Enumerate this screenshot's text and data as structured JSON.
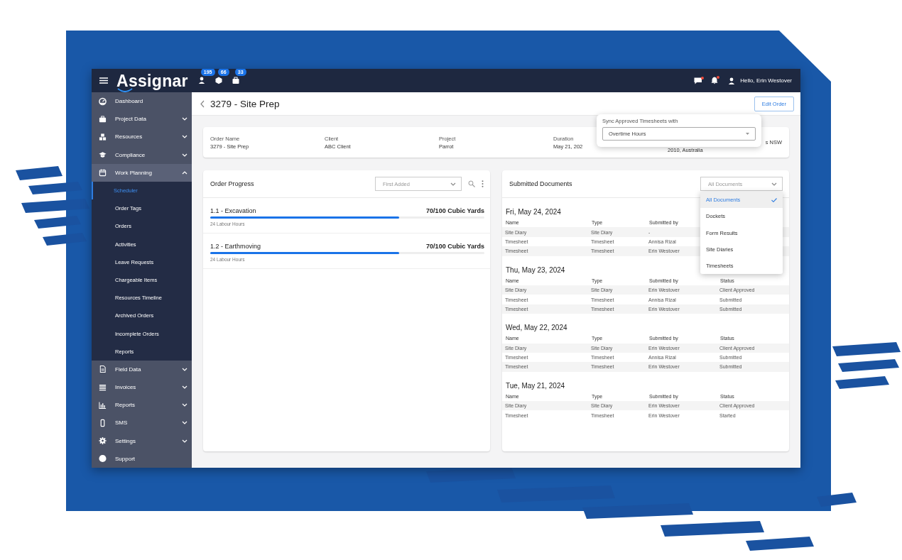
{
  "topbar": {
    "logo": "Assignar",
    "badges": [
      {
        "count": "195"
      },
      {
        "count": "66"
      },
      {
        "count": "33"
      }
    ],
    "greeting": "Hello, Erin Westover"
  },
  "sidebar": {
    "items": [
      {
        "label": "Dashboard"
      },
      {
        "label": "Project Data",
        "expanded": false
      },
      {
        "label": "Resources",
        "expanded": false
      },
      {
        "label": "Compliance",
        "expanded": false
      },
      {
        "label": "Work Planning",
        "expanded": true,
        "children": [
          {
            "label": "Scheduler",
            "selected": true
          },
          {
            "label": "Order Tags",
            "selected": false
          },
          {
            "label": "Orders",
            "selected": false
          },
          {
            "label": "Activities",
            "selected": false
          },
          {
            "label": "Leave Requests",
            "selected": false
          },
          {
            "label": "Chargeable Items",
            "selected": false
          },
          {
            "label": "Resources Timeline",
            "selected": false
          },
          {
            "label": "Archived Orders",
            "selected": false
          },
          {
            "label": "Incomplete Orders",
            "selected": false
          },
          {
            "label": "Reports",
            "selected": false
          }
        ]
      },
      {
        "label": "Field Data",
        "expanded": false
      },
      {
        "label": "Invoices",
        "expanded": false
      },
      {
        "label": "Reports",
        "expanded": false
      },
      {
        "label": "SMS",
        "expanded": false
      },
      {
        "label": "Settings",
        "expanded": false
      },
      {
        "label": "Support"
      }
    ]
  },
  "header": {
    "title": "3279 - Site Prep",
    "edit_button": "Edit Order"
  },
  "order_info": {
    "fields": [
      {
        "label": "Order Name",
        "value": "3279 - Site Prep"
      },
      {
        "label": "Client",
        "value": "ABC Client"
      },
      {
        "label": "Project",
        "value": "Parrot"
      },
      {
        "label": "Duration",
        "value": "May 21, 202"
      },
      {
        "value_lines": [
          "s NSW",
          "2010, Australia"
        ]
      }
    ]
  },
  "sync_popup": {
    "label": "Sync Approved Timesheets with",
    "value": "Overtime Hours"
  },
  "order_progress": {
    "title": "Order Progress",
    "sort": "First Added",
    "items": [
      {
        "name": "1.1 - Excavation",
        "quantity": "70/100 Cubic Yards",
        "level": 0.69,
        "hours": "24 Labour Hours"
      },
      {
        "name": "1.2 - Earthmoving",
        "quantity": "70/100 Cubic Yards",
        "level": 0.69,
        "hours": "24 Labour Hours"
      }
    ]
  },
  "submitted_documents": {
    "title": "Submitted Documents",
    "filter": "All Documents",
    "filter_menu": [
      {
        "label": "All Documents",
        "selected": true
      },
      {
        "label": "Dockets",
        "selected": false
      },
      {
        "label": "Form Results",
        "selected": false
      },
      {
        "label": "Site Diaries",
        "selected": false
      },
      {
        "label": "Timesheets",
        "selected": false
      }
    ],
    "groups": [
      {
        "date": "Fri, May 24, 2024",
        "columns": [
          "Name",
          "Type",
          "Submitted by"
        ],
        "rows": [
          [
            "Site Diary",
            "Site Diary",
            "-"
          ],
          [
            "Timesheet",
            "Timesheet",
            "Annisa Rizal"
          ],
          [
            "Timesheet",
            "Timesheet",
            "Erin Westover"
          ]
        ]
      },
      {
        "date": "Thu, May 23, 2024",
        "columns": [
          "Name",
          "Type",
          "Submitted by",
          "Status"
        ],
        "rows": [
          [
            "Site Diary",
            "Site Diary",
            "Erin Westover",
            "Client Approved"
          ],
          [
            "Timesheet",
            "Timesheet",
            "Annisa Rizal",
            "Submitted"
          ],
          [
            "Timesheet",
            "Timesheet",
            "Erin Westover",
            "Submitted"
          ]
        ]
      },
      {
        "date": "Wed, May 22, 2024",
        "columns": [
          "Name",
          "Type",
          "Submitted by",
          "Status"
        ],
        "rows": [
          [
            "Site Diary",
            "Site Diary",
            "Erin Westover",
            "Client Approved"
          ],
          [
            "Timesheet",
            "Timesheet",
            "Annisa Rizal",
            "Submitted"
          ],
          [
            "Timesheet",
            "Timesheet",
            "Erin Westover",
            "Submitted"
          ]
        ]
      },
      {
        "date": "Tue, May 21, 2024",
        "columns": [
          "Name",
          "Type",
          "Submitted by",
          "Status"
        ],
        "rows": [
          [
            "Site Diary",
            "Site Diary",
            "Erin Westover",
            "Client Approved"
          ],
          [
            "Timesheet",
            "Timesheet",
            "Erin Westover",
            "Started"
          ]
        ]
      }
    ]
  }
}
